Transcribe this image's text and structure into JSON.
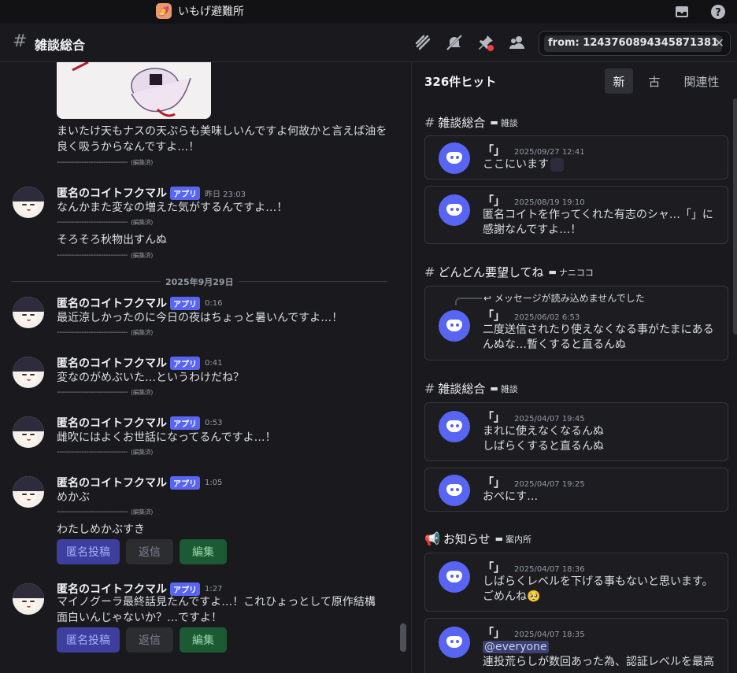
{
  "titlebar": {
    "server_name": "いもげ避難所",
    "server_icon": "🍠"
  },
  "channel": {
    "name": "雑談総合"
  },
  "search": {
    "query": "from: 1243760894345871381"
  },
  "chat": {
    "top_message": {
      "text": "まいたけ天もナスの天ぷらも美味しいんですよ何故かと言えば油を良く吸うからなんですよ…！",
      "dashes": "-----------------------------",
      "edited": "(編集済)"
    },
    "messages": [
      {
        "author": "匿名のコイトフクマル",
        "badge": "アプリ",
        "time": "昨日 23:03",
        "text": "なんかまた変なの増えた気がするんですよ…！",
        "dashes": "-----------------------------",
        "edited": "(編集済)",
        "text2": "そろそろ秋物出すんぬ",
        "dashes2": "-----------------------------",
        "edited2": "(編集済)"
      },
      {
        "author": "匿名のコイトフクマル",
        "badge": "アプリ",
        "time": "0:16",
        "text": "最近涼しかったのに今日の夜はちょっと暑いんですよ…！",
        "dashes": "-----------------------------",
        "edited": "(編集済)"
      },
      {
        "author": "匿名のコイトフクマル",
        "badge": "アプリ",
        "time": "0:41",
        "text": "変なのがめぶいた…というわけだね？",
        "dashes": "-----------------------------",
        "edited": "(編集済)"
      },
      {
        "author": "匿名のコイトフクマル",
        "badge": "アプリ",
        "time": "0:53",
        "text": "雌吹にはよくお世話になってるんですよ…！",
        "dashes": "-----------------------------",
        "edited": "(編集済)"
      },
      {
        "author": "匿名のコイトフクマル",
        "badge": "アプリ",
        "time": "1:05",
        "text": "めかぶ",
        "dashes": "-----------------------------",
        "edited": "(編集済)",
        "text2": "わたしめかぶすき"
      },
      {
        "author": "匿名のコイトフクマル",
        "badge": "アプリ",
        "time": "1:27",
        "text": "マイノグーラ最終話見たんですよ…！これひょっとして原作結構面白いんじゃないか？…ですよ！"
      }
    ],
    "date_divider": "2025年9月29日",
    "buttons": {
      "anon": "匿名投稿",
      "reply": "返信",
      "edit": "編集"
    }
  },
  "results": {
    "count": "326件ヒット",
    "sort_tabs": [
      "新",
      "古",
      "関連性"
    ],
    "groups": [
      {
        "channel": "雑談総合",
        "category": "雑談"
      },
      {
        "channel": "どんどん要望してね",
        "category": "ナニココ"
      },
      {
        "channel": "雑談総合",
        "category": "雑談"
      },
      {
        "channel": "お知らせ",
        "category": "案内所"
      }
    ],
    "cards": [
      {
        "name": "「」",
        "time": "2025/09/27 12:41",
        "text": "ここにいます"
      },
      {
        "name": "「」",
        "time": "2025/08/19 19:10",
        "text": "匿名コイトを作ってくれた有志のシャ…「」に感謝なんですよ…！"
      },
      {
        "name": "「」",
        "time": "2025/06/02 6:53",
        "reply": "メッセージが読み込めませんでした",
        "text": "二度送信されたり使えなくなる事がたまにあるんぬな…暫くすると直るんぬ"
      },
      {
        "name": "「」",
        "time": "2025/04/07 19:45",
        "text": "まれに使えなくなるんぬ",
        "text2": "しばらくすると直るんぬ"
      },
      {
        "name": "「」",
        "time": "2025/04/07 19:25",
        "text": "おぺにす…"
      },
      {
        "name": "「」",
        "time": "2025/04/07 18:36",
        "text": "しばらくレベルを下げる事もないと思います。",
        "text2": "ごめんね🥺"
      },
      {
        "name": "「」",
        "time": "2025/04/07 18:35",
        "mention": "@everyone",
        "text": "連投荒らしが数回あった為、認証レベルを最高"
      }
    ]
  }
}
